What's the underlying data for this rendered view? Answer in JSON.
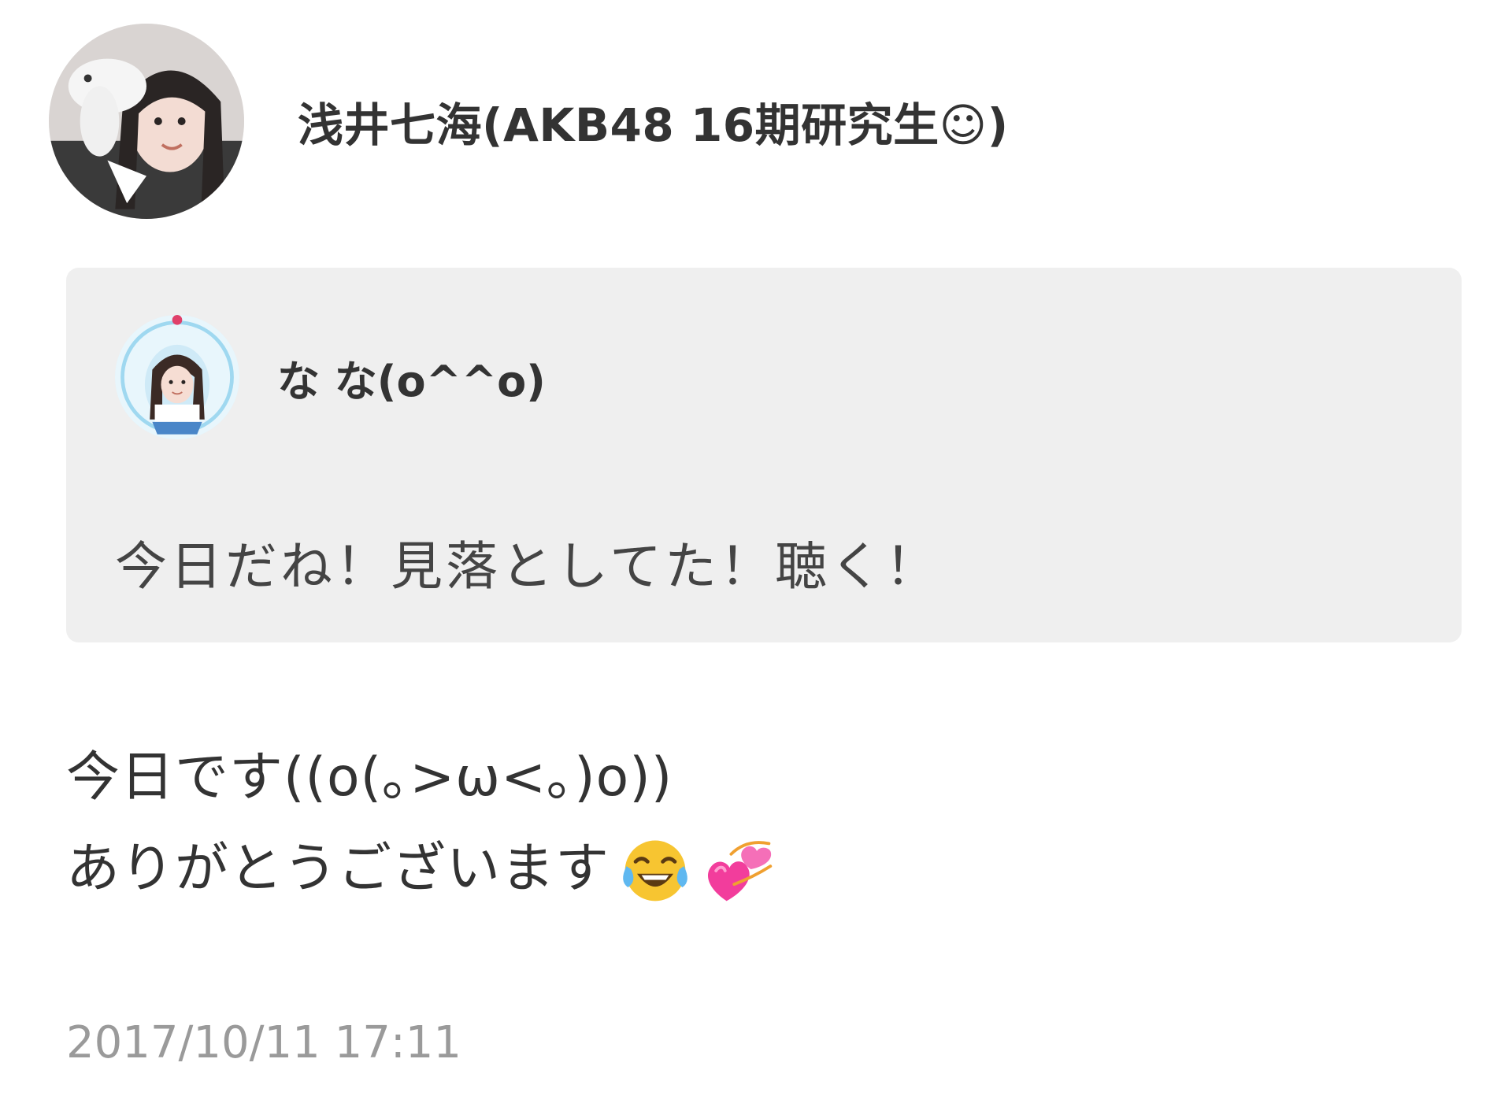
{
  "post": {
    "author_name": "浅井七海(AKB48 16期研究生☺)",
    "author_avatar_icon": "profile-photo",
    "quote": {
      "author_name": "な な(o^^o)",
      "author_avatar_icon": "profile-photo",
      "text": "今日だね！見落としてた！聴く！"
    },
    "reply_lines": [
      "今日です((o(｡>ω<｡)o))",
      "ありがとうございます"
    ],
    "emojis": [
      "face-with-tears-of-joy-emoji",
      "two-hearts-emoji"
    ],
    "timestamp": "2017/10/11 17:11"
  },
  "colors": {
    "background": "#ffffff",
    "quote_background": "#efefef",
    "timestamp": "#9a9a9a",
    "text": "#333333"
  }
}
